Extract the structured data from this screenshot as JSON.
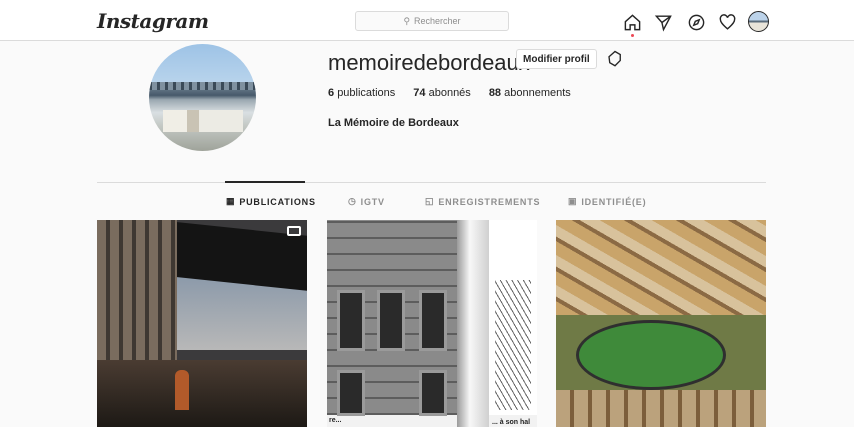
{
  "header": {
    "logo": "Instagram",
    "search_placeholder": "Rechercher"
  },
  "profile": {
    "username": "memoiredebordeaux",
    "edit_button": "Modifier profil",
    "stats": {
      "posts_count": "6",
      "posts_label": "publications",
      "followers_count": "74",
      "followers_label": "abonnés",
      "following_count": "88",
      "following_label": "abonnements"
    },
    "full_name": "La Mémoire de Bordeaux"
  },
  "tabs": [
    {
      "label": "PUBLICATIONS",
      "icon": "grid-icon",
      "active": true
    },
    {
      "label": "IGTV",
      "icon": "igtv-icon",
      "active": false
    },
    {
      "label": "ENREGISTREMENTS",
      "icon": "bookmark-icon",
      "active": false
    },
    {
      "label": "IDENTIFIÉ(E)",
      "icon": "tagged-icon",
      "active": false
    }
  ],
  "posts": [
    {
      "kind": "video",
      "icon": "video-icon"
    },
    {
      "kind": "photo",
      "caption_left": "re...",
      "caption_right": "... à son hal"
    },
    {
      "kind": "photo"
    }
  ],
  "colors": {
    "notification_dot": "#ed4956",
    "border": "#dbdbdb",
    "background": "#fafafa"
  }
}
